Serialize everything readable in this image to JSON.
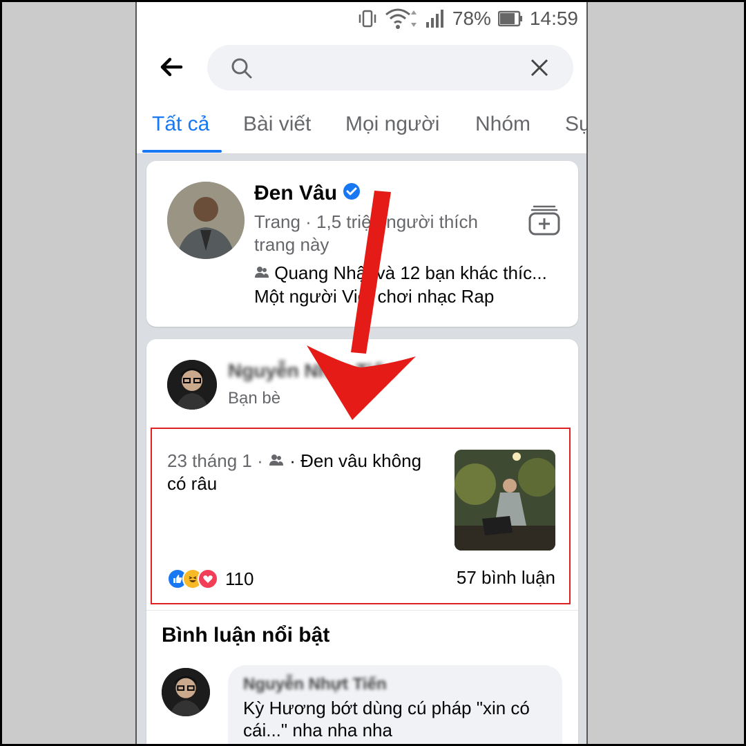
{
  "status_bar": {
    "battery": "78%",
    "time": "14:59"
  },
  "search": {
    "placeholder": "",
    "value": ""
  },
  "tabs": [
    {
      "label": "Tất cả"
    },
    {
      "label": "Bài viết"
    },
    {
      "label": "Mọi người"
    },
    {
      "label": "Nhóm"
    },
    {
      "label": "Sụ"
    }
  ],
  "page_result": {
    "name": "Đen Vâu",
    "meta": "Trang · 1,5 triệu người thích trang này",
    "friends_liked": "Quang Nhật và 12 bạn khác thíc...",
    "description": "Một người Việt chơi nhạc Rap"
  },
  "post_result": {
    "author": "Nguyễn Nhựt Tiến",
    "relation": "Bạn bè",
    "date": "23 tháng 1 ·",
    "text": " · Đen vâu không có râu",
    "reaction_count": "110",
    "comment_count": "57 bình luận"
  },
  "featured_comments": {
    "title": "Bình luận nổi bật",
    "author": "Nguyễn Nhựt Tiến",
    "text": "Kỳ Hương bớt dùng cú pháp \"xin có cái...\" nha nha nha"
  },
  "colors": {
    "accent": "#1877f2",
    "highlight_box": "#e02020",
    "annotation_arrow": "#e41b17"
  },
  "icons": [
    "back-arrow-icon",
    "search-icon",
    "close-icon",
    "verified-icon",
    "add-page-icon",
    "friends-icon",
    "like-icon",
    "haha-icon",
    "love-icon",
    "vibrate-icon",
    "wifi-icon",
    "signal-icon",
    "battery-icon"
  ]
}
